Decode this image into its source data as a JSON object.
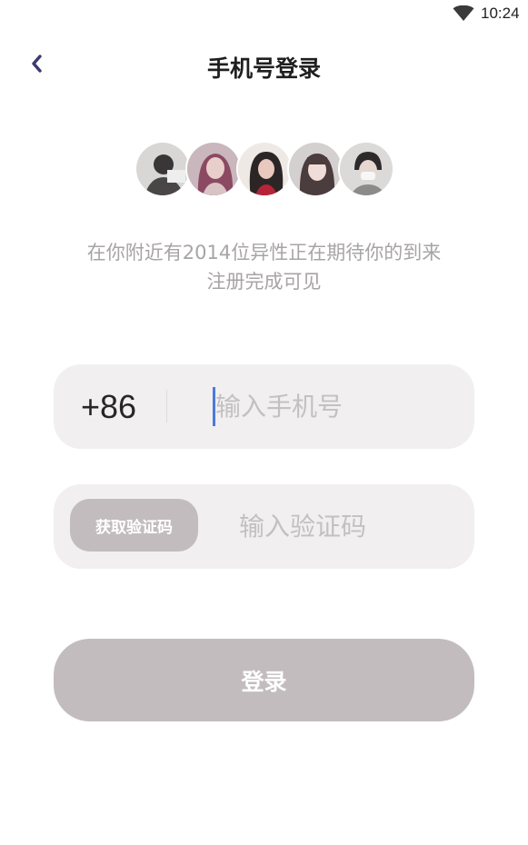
{
  "status_bar": {
    "time": "10:24",
    "wifi_icon": "wifi-icon"
  },
  "header": {
    "back_icon": "chevron-left-icon",
    "title": "手机号登录"
  },
  "avatars": {
    "count": 5
  },
  "subtitle": {
    "line1": "在你附近有2014位异性正在期待你的到来",
    "line2": "注册完成可见"
  },
  "phone_field": {
    "country_code": "+86",
    "value": "",
    "placeholder": "输入手机号"
  },
  "code_field": {
    "get_code_label": "获取验证码",
    "value": "",
    "placeholder": "输入验证码"
  },
  "login_button": {
    "label": "登录"
  },
  "colors": {
    "accent": "#3b3b6e",
    "field_background": "#f1eff0",
    "button_disabled": "#c3bcbe",
    "caret": "#4a7bd9",
    "subtitle_text": "#a8a4a4"
  }
}
